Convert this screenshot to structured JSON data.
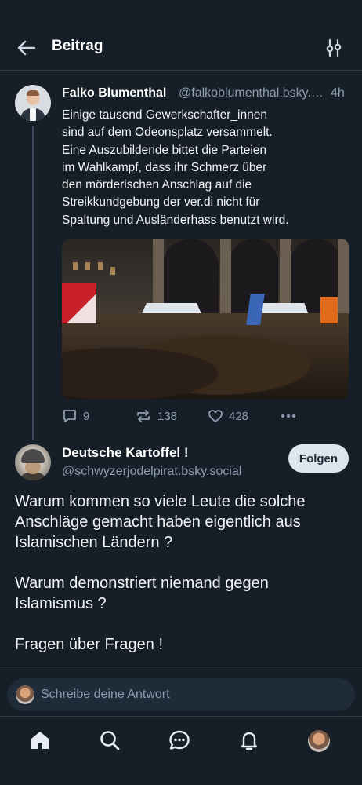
{
  "header": {
    "title": "Beitrag",
    "back_icon": "arrow-left-icon",
    "filter_icon": "sliders-icon"
  },
  "post1": {
    "author_name": "Falko Blumenthal",
    "author_handle": "@falkoblumenthal.bsky.social",
    "time": "4h",
    "text_lines": [
      "Einige tausend Gewerkschafter_innen",
      "sind auf dem Odeonsplatz versammelt.",
      "Eine Auszubildende bittet die Parteien",
      "im Wahlkampf, dass ihr Schmerz über",
      "den mörderischen Anschlag auf die",
      "Streikkundgebung der ver.di nicht für",
      "Spaltung und Ausländerhass benutzt wird."
    ],
    "stats": {
      "replies": "9",
      "reposts": "138",
      "likes": "428"
    }
  },
  "post2": {
    "author_name": "Deutsche Kartoffel !",
    "author_handle": "@schwyzerjodelpirat.bsky.social",
    "follow_label": "Folgen",
    "paragraphs": [
      [
        "Warum kommen so viele Leute die solche",
        "Anschläge gemacht haben eigentlich aus",
        "Islamischen Ländern ?"
      ],
      [
        "Warum demonstriert niemand gegen",
        "Islamismus ?"
      ],
      [
        "Fragen über Fragen !"
      ]
    ]
  },
  "reply": {
    "placeholder": "Schreibe deine Antwort"
  },
  "nav": {
    "items": [
      "home-icon",
      "search-icon",
      "chat-icon",
      "bell-icon",
      "profile-avatar"
    ]
  },
  "colors": {
    "background": "#161e27",
    "muted": "#8c9db0",
    "follow_bg": "#dfe5ec"
  }
}
